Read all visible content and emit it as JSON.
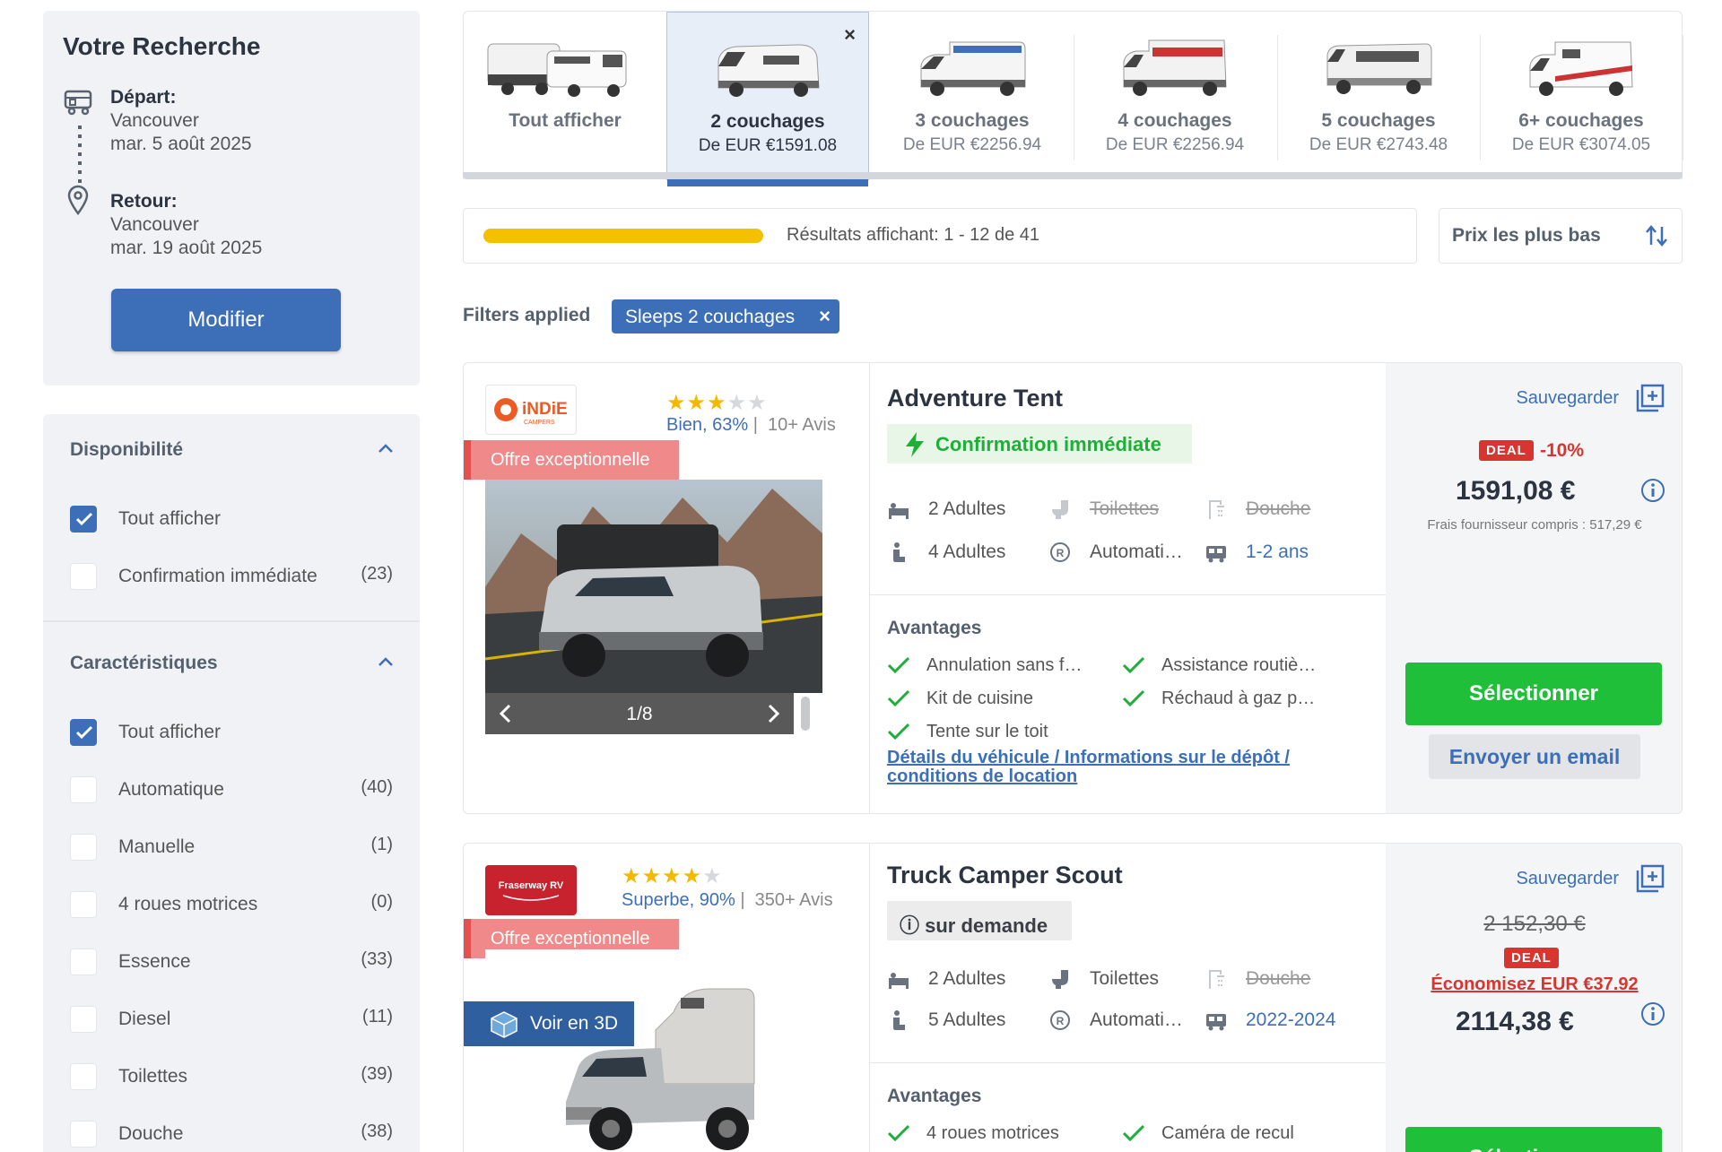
{
  "search": {
    "title": "Votre Recherche",
    "departure_label": "Départ:",
    "departure_city": "Vancouver",
    "departure_date": "mar. 5 août 2025",
    "return_label": "Retour:",
    "return_city": "Vancouver",
    "return_date": "mar. 19 août 2025",
    "modify_label": "Modifier"
  },
  "filters": {
    "availability": {
      "title": "Disponibilité",
      "items": [
        {
          "label": "Tout afficher",
          "count": "",
          "checked": true
        },
        {
          "label": "Confirmation immédiate",
          "count": "(23)",
          "checked": false
        }
      ]
    },
    "features": {
      "title": "Caractéristiques",
      "items": [
        {
          "label": "Tout afficher",
          "count": "",
          "checked": true
        },
        {
          "label": "Automatique",
          "count": "(40)",
          "checked": false
        },
        {
          "label": "Manuelle",
          "count": "(1)",
          "checked": false
        },
        {
          "label": "4 roues motrices",
          "count": "(0)",
          "checked": false
        },
        {
          "label": "Essence",
          "count": "(33)",
          "checked": false
        },
        {
          "label": "Diesel",
          "count": "(11)",
          "checked": false
        },
        {
          "label": "Toilettes",
          "count": "(39)",
          "checked": false
        },
        {
          "label": "Douche",
          "count": "(38)",
          "checked": false
        }
      ]
    }
  },
  "tabs": [
    {
      "name": "Tout afficher",
      "price": "",
      "active": false
    },
    {
      "name": "2 couchages",
      "price": "De EUR €1591.08",
      "active": true
    },
    {
      "name": "3 couchages",
      "price": "De EUR €2256.94",
      "active": false
    },
    {
      "name": "4 couchages",
      "price": "De EUR €2256.94",
      "active": false
    },
    {
      "name": "5 couchages",
      "price": "De EUR €2743.48",
      "active": false
    },
    {
      "name": "6+ couchages",
      "price": "De EUR €3074.05",
      "active": false
    }
  ],
  "results": {
    "text": "Résultats affichant: 1 - 12 de 41",
    "progress": 1.0,
    "sort_label": "Prix les plus bas"
  },
  "applied": {
    "label": "Filters applied",
    "chip": "Sleeps 2 couchages",
    "chip_close": "×"
  },
  "listings": [
    {
      "title": "Adventure Tent",
      "brand": "iNDiE",
      "brand_sub": "CAMPERS",
      "stars": 3,
      "rating_word": "Bien, 63%",
      "reviews": "10+ Avis",
      "offer": "Offre exceptionnelle",
      "gallery": "1/8",
      "badge": "Confirmation immédiate",
      "specs": {
        "adults_sleep": "2 Adultes",
        "toilets": "Toilettes",
        "shower": "Douche",
        "adults_seat": "4 Adultes",
        "transmission": "Automati…",
        "age": "1-2 ans"
      },
      "advantages_title": "Avantages",
      "advantages": [
        "Annulation sans f…",
        "Assistance routiè…",
        "Kit de cuisine",
        "Réchaud à gaz p…",
        "Tente sur le toit"
      ],
      "details_link": "Détails du véhicule / Informations sur le dépôt / conditions de location",
      "save": "Sauvegarder",
      "deal": "DEAL",
      "discount": "-10%",
      "price": "1591,08 €",
      "fees": "Frais fournisseur compris : 517,29 €",
      "select": "Sélectionner",
      "email": "Envoyer un email"
    },
    {
      "title": "Truck Camper Scout",
      "brand": "Fraserway RV",
      "stars": 4,
      "rating_word": "Superbe, 90%",
      "reviews": "350+ Avis",
      "offer": "Offre exceptionnelle",
      "view3d": "Voir en 3D",
      "badge": "sur demande",
      "specs": {
        "adults_sleep": "2 Adultes",
        "toilets": "Toilettes",
        "shower": "Douche",
        "adults_seat": "5 Adultes",
        "transmission": "Automati…",
        "age": "2022-2024"
      },
      "advantages_title": "Avantages",
      "advantages": [
        "4 roues motrices",
        "Caméra de recul"
      ],
      "save": "Sauvegarder",
      "old_price": "2 152,30 €",
      "deal": "DEAL",
      "savings": "Économisez EUR €37.92",
      "price": "2114,38 €",
      "select": "Sélectionner"
    }
  ],
  "colors": {
    "primary": "#3d6fb8",
    "green": "#1fbf3a",
    "deal_red": "#d93530",
    "star": "#f5b800",
    "offer": "#f08a8a",
    "progress": "#f5c000"
  }
}
